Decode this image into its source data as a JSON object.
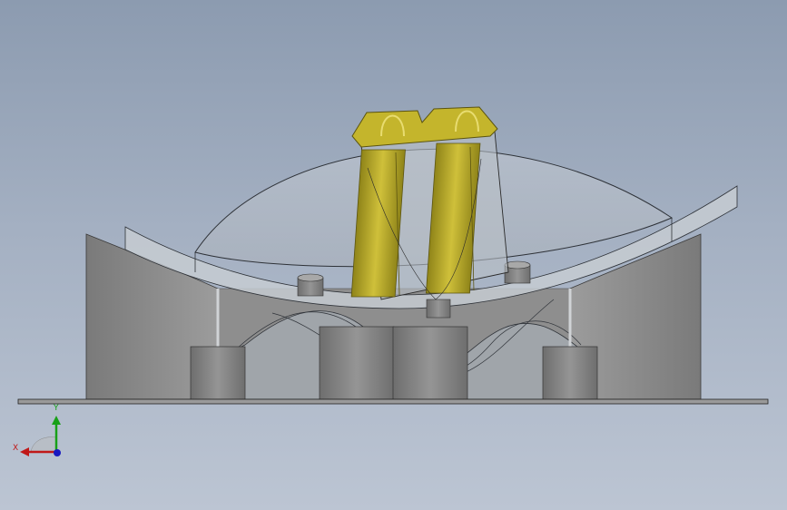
{
  "viewport": {
    "background_top": "#8c9bb0",
    "background_bottom": "#bcc5d3"
  },
  "model": {
    "components": [
      {
        "name": "base-plate",
        "color": "#9a9a9a"
      },
      {
        "name": "side-wall-left",
        "color": "#8a8a8a"
      },
      {
        "name": "side-wall-right",
        "color": "#8a8a8a"
      },
      {
        "name": "dome-cover",
        "color": "#b8bec6"
      },
      {
        "name": "curved-rail",
        "color": "#c9cdd2"
      },
      {
        "name": "wave-channel",
        "color": "#a8adb3"
      },
      {
        "name": "support-post-left",
        "color": "#7e7e7e"
      },
      {
        "name": "support-post-right",
        "color": "#7e7e7e"
      },
      {
        "name": "connector-clip",
        "color": "#b9a81e"
      }
    ],
    "accent_color": "#c2b12a"
  },
  "triad": {
    "x_label": "X",
    "y_label": "Y",
    "x_color": "#c01818",
    "y_color": "#18a018",
    "z_color": "#1818c0"
  }
}
